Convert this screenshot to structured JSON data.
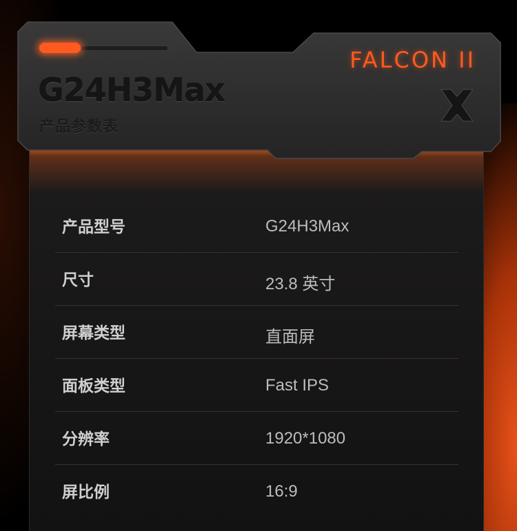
{
  "header": {
    "model": "G24H3Max",
    "subtitle": "产品参数表",
    "brand": "FALCON II"
  },
  "icons": [
    "close-x-icon"
  ],
  "colors": {
    "accent": "#ff5a1f",
    "background": "#000000",
    "panel": "#2a2929"
  },
  "specs": [
    {
      "label": "产品型号",
      "value": "G24H3Max"
    },
    {
      "label": "尺寸",
      "value": "23.8 英寸"
    },
    {
      "label": "屏幕类型",
      "value": "直面屏"
    },
    {
      "label": "面板类型",
      "value": "Fast IPS"
    },
    {
      "label": "分辨率",
      "value": "1920*1080"
    },
    {
      "label": "屏比例",
      "value": "16:9"
    }
  ]
}
